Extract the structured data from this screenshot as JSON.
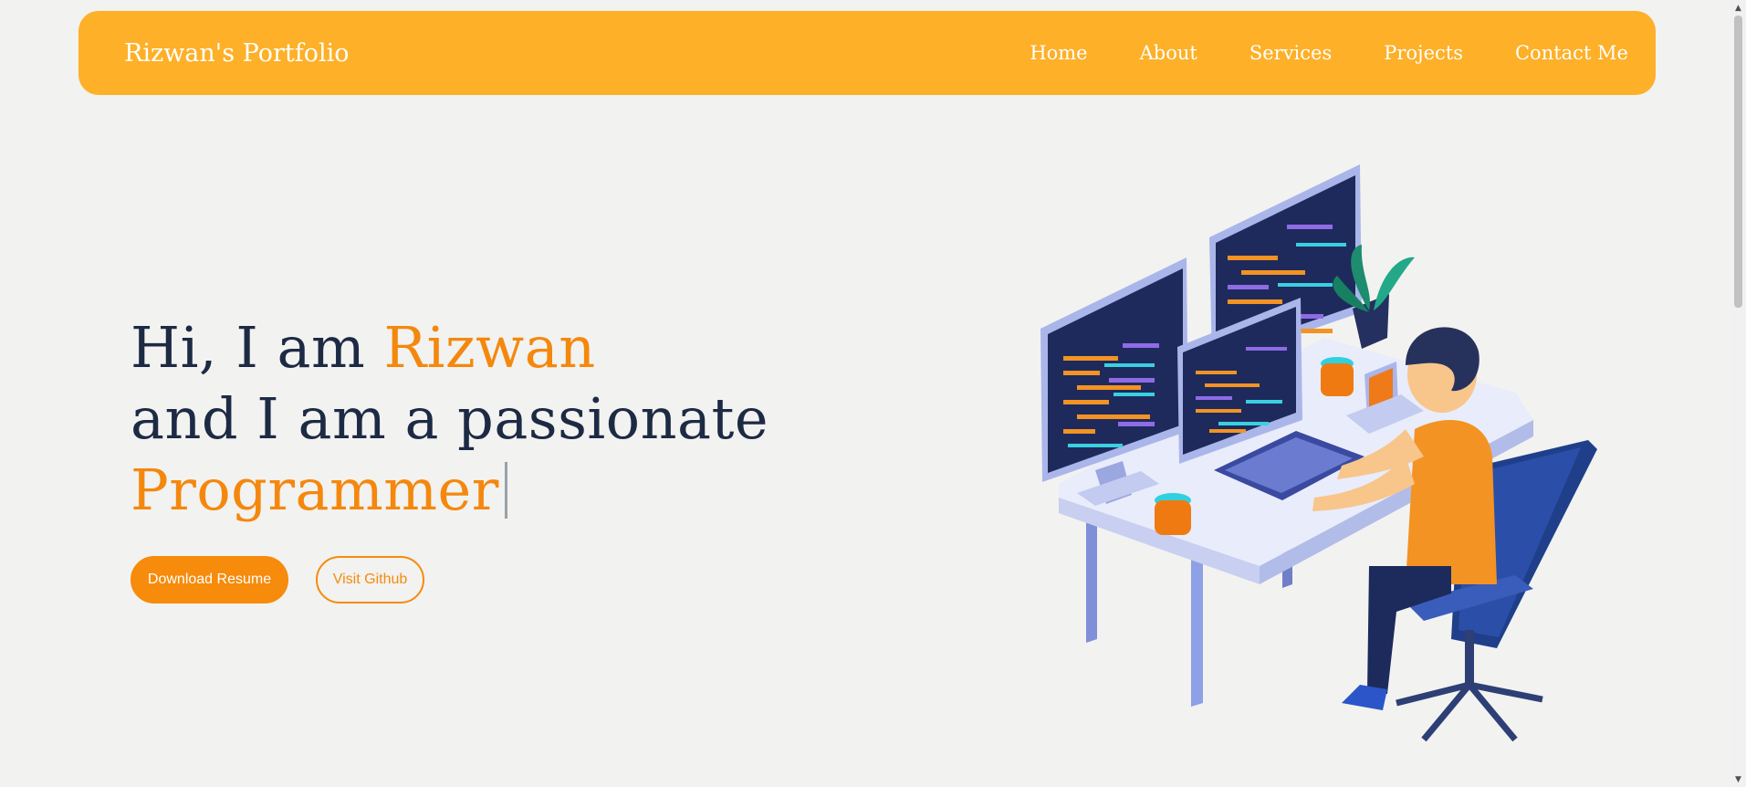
{
  "nav": {
    "brand": "Rizwan's Portfolio",
    "links": [
      "Home",
      "About",
      "Services",
      "Projects",
      "Contact Me"
    ]
  },
  "hero": {
    "line1_prefix": "Hi, I am ",
    "line1_name": "Rizwan",
    "line2": "and I am a passionate",
    "line3_role": "Programmer"
  },
  "buttons": {
    "download": "Download Resume",
    "github": "Visit Github"
  },
  "colors": {
    "navbar": "#fdb028",
    "accent": "#f4880e",
    "text": "#1d2a44",
    "background": "#f2f2f0"
  },
  "illustration": {
    "icon": "developer-at-desk-illustration"
  }
}
